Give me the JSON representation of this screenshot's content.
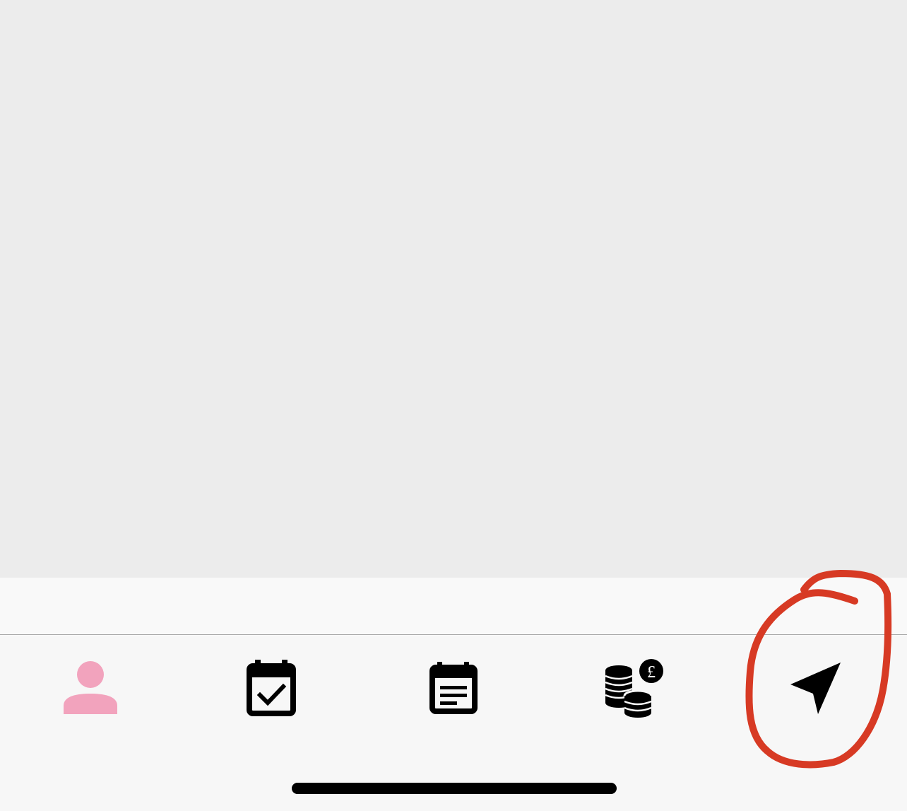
{
  "colors": {
    "content_background": "#ececec",
    "tab_bar_background": "#f7f7f7",
    "active_tab": "#f2a3bd",
    "inactive_tab": "#000000",
    "annotation": "#d73a24"
  },
  "tab_bar": {
    "active_index": 0,
    "tabs": [
      {
        "icon": "person-icon",
        "active": true
      },
      {
        "icon": "calendar-check-icon",
        "active": false
      },
      {
        "icon": "calendar-notes-icon",
        "active": false
      },
      {
        "icon": "coins-pound-icon",
        "active": false,
        "badge_symbol": "£"
      },
      {
        "icon": "navigation-arrow-icon",
        "active": false
      }
    ]
  },
  "annotation": {
    "shape": "hand-drawn-circle",
    "target": "navigation-arrow-icon"
  }
}
